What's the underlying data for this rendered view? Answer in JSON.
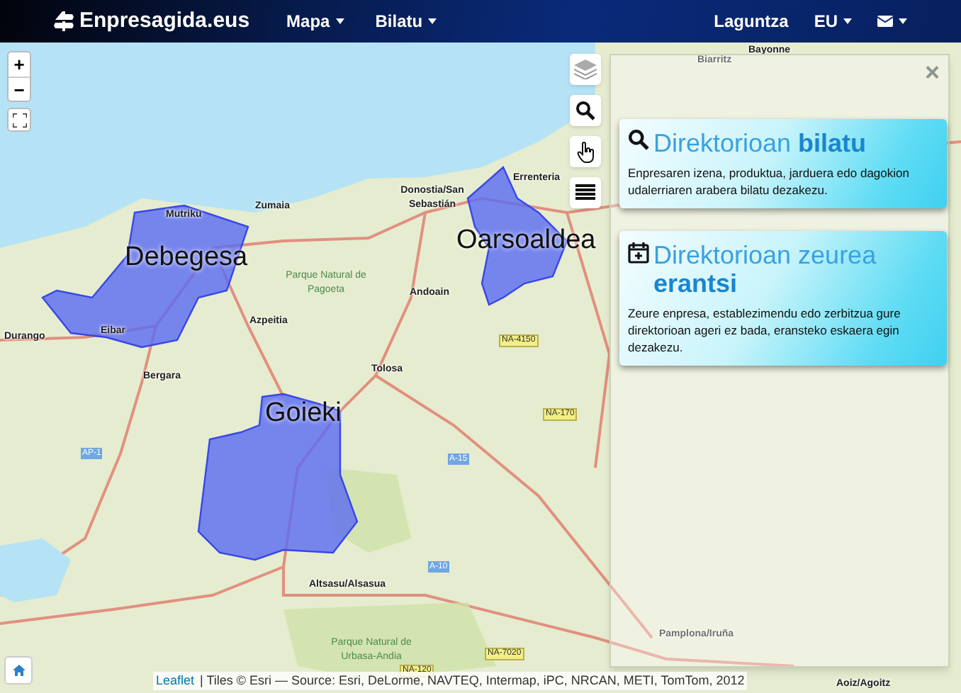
{
  "navbar": {
    "brand": "Enpresagida.eus",
    "menus": [
      {
        "label": "Mapa",
        "dropdown": true
      },
      {
        "label": "Bilatu",
        "dropdown": true
      }
    ],
    "right": [
      {
        "kind": "text",
        "label": "Laguntza",
        "dropdown": false
      },
      {
        "kind": "text",
        "label": "EU",
        "dropdown": true
      },
      {
        "kind": "mail",
        "dropdown": true
      }
    ]
  },
  "map": {
    "zoom_in": "+",
    "zoom_out": "−",
    "regions": [
      {
        "label": "Debegesa"
      },
      {
        "label": "Oarsoaldea"
      },
      {
        "label": "Goieki"
      }
    ],
    "places": [
      {
        "label": "Bayonne",
        "kind": "town"
      },
      {
        "label": "Biarritz",
        "kind": "town"
      },
      {
        "label": "Mutriku",
        "kind": "town"
      },
      {
        "label": "Zumaia",
        "kind": "town"
      },
      {
        "label": "Donostia/San Sebastián",
        "kind": "town"
      },
      {
        "label": "Errenteria",
        "kind": "town"
      },
      {
        "label": "Parque Natural de Pagoeta",
        "kind": "park"
      },
      {
        "label": "Andoain",
        "kind": "town"
      },
      {
        "label": "Azpeitia",
        "kind": "town"
      },
      {
        "label": "Durango",
        "kind": "town"
      },
      {
        "label": "Eibar",
        "kind": "town"
      },
      {
        "label": "Bergara",
        "kind": "town"
      },
      {
        "label": "Tolosa",
        "kind": "town"
      },
      {
        "label": "NA-4150",
        "kind": "road"
      },
      {
        "label": "NA-170",
        "kind": "road"
      },
      {
        "label": "A-15",
        "kind": "motorway"
      },
      {
        "label": "AP-1",
        "kind": "motorway"
      },
      {
        "label": "A-10",
        "kind": "motorway"
      },
      {
        "label": "Altsasu/Alsasua",
        "kind": "town"
      },
      {
        "label": "Parque Natural de Urbasa-Andia",
        "kind": "park"
      },
      {
        "label": "NA-7020",
        "kind": "road"
      },
      {
        "label": "NA-120",
        "kind": "road"
      },
      {
        "label": "Pamplona/Iruña",
        "kind": "town"
      },
      {
        "label": "Aoiz/Agoitz",
        "kind": "town"
      }
    ],
    "attribution": {
      "link": "Leaflet",
      "text": "| Tiles © Esri — Source: Esri, DeLorme, NAVTEQ, Intermap, iPC, NRCAN, METI, TomTom, 2012"
    }
  },
  "panel": {
    "close": "×",
    "cards": [
      {
        "kind": "search",
        "title": "Direktorioan **bilatu**",
        "body": "Enpresaren izena, produktua, jarduera edo dagokion udalerriaren arabera bilatu dezakezu."
      },
      {
        "kind": "add",
        "title": "Direktorioan zeurea **erantsi**",
        "body": "Zeure enpresa, establezimendu edo zerbitzua gure direktorioan ageri ez bada, eransteko eskaera egin dezakezu."
      }
    ]
  }
}
